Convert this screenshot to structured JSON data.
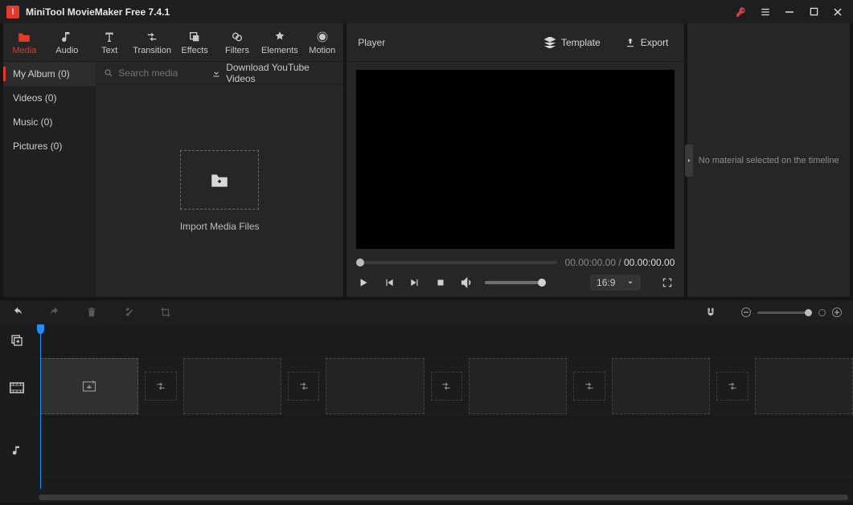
{
  "titlebar": {
    "app_title": "MiniTool MovieMaker Free 7.4.1"
  },
  "toolTabs": [
    {
      "id": "media",
      "label": "Media"
    },
    {
      "id": "audio",
      "label": "Audio"
    },
    {
      "id": "text",
      "label": "Text"
    },
    {
      "id": "transition",
      "label": "Transition"
    },
    {
      "id": "effects",
      "label": "Effects"
    },
    {
      "id": "filters",
      "label": "Filters"
    },
    {
      "id": "elements",
      "label": "Elements"
    },
    {
      "id": "motion",
      "label": "Motion"
    }
  ],
  "mediaCats": [
    {
      "id": "album",
      "label": "My Album (0)"
    },
    {
      "id": "videos",
      "label": "Videos (0)"
    },
    {
      "id": "music",
      "label": "Music (0)"
    },
    {
      "id": "pictures",
      "label": "Pictures (0)"
    }
  ],
  "mediaToolbar": {
    "search_placeholder": "Search media",
    "download_label": "Download YouTube Videos"
  },
  "import": {
    "caption": "Import Media Files"
  },
  "player": {
    "label": "Player",
    "template_label": "Template",
    "export_label": "Export",
    "cur_time": "00.00:00.00",
    "sep": " / ",
    "duration": "00.00:00.00",
    "aspect": "16:9"
  },
  "rightPanel": {
    "empty_text": "No material selected on the timeline"
  }
}
